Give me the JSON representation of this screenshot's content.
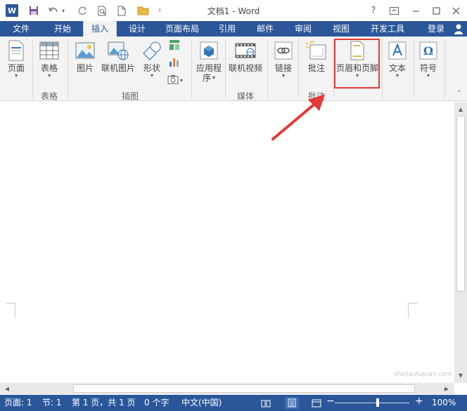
{
  "titlebar": {
    "app_icon": "W",
    "title": "文档1 - Word",
    "help": "?",
    "icons": [
      "word-app-icon",
      "save-icon",
      "undo-icon",
      "redo-icon",
      "print-preview-icon",
      "new-document-icon",
      "open-folder-icon",
      "customize-qat-icon",
      "help-icon",
      "ribbon-display-icon",
      "minimize-icon",
      "maximize-icon",
      "close-icon"
    ]
  },
  "tabs": [
    {
      "label": "文件"
    },
    {
      "label": "开始"
    },
    {
      "label": "插入"
    },
    {
      "label": "设计"
    },
    {
      "label": "页面布局"
    },
    {
      "label": "引用"
    },
    {
      "label": "邮件"
    },
    {
      "label": "审阅"
    },
    {
      "label": "视图"
    },
    {
      "label": "开发工具"
    }
  ],
  "signin": "登录",
  "ribbon": {
    "buttons": {
      "page": "页面",
      "table": "表格",
      "picture": "图片",
      "online_picture": "联机图片",
      "shapes": "形状",
      "apps_line1": "应用程",
      "apps_line2": "序",
      "online_video": "联机视频",
      "link": "链接",
      "comment": "批注",
      "header_footer": "页眉和页脚",
      "text": "文本",
      "symbol": "符号"
    },
    "groups": {
      "tables": "表格",
      "illustrations": "插图",
      "media": "媒体",
      "comments": "批注"
    }
  },
  "statusbar": {
    "page": "页面: 1",
    "section": "节: 1",
    "page_of": "第 1 页，共 1 页",
    "words": "0 个字",
    "language": "中文(中国)",
    "zoom_minus": "−",
    "zoom_plus": "+",
    "zoom": "100%"
  },
  "watermark": "shejiaotupian.com",
  "colors": {
    "brand_blue": "#2b579a",
    "ribbon_bg": "#f3f3f3",
    "highlight_red": "#e53935"
  }
}
